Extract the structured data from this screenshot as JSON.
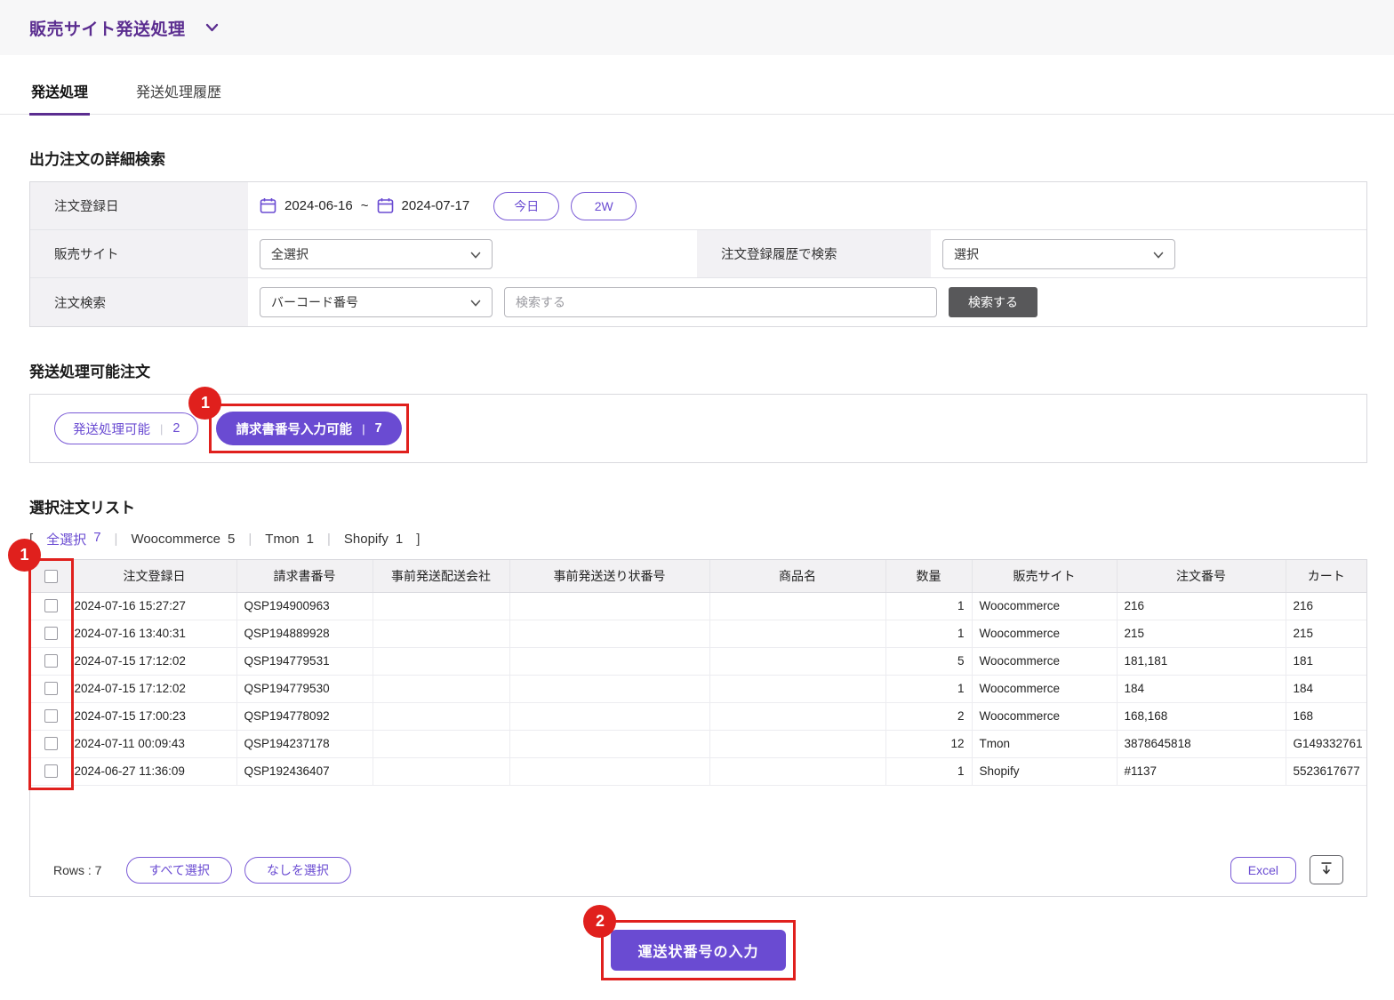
{
  "colors": {
    "accent": "#6a4bd2",
    "accent_deep": "#5b2d90",
    "annotation_red": "#e0201d",
    "dark_button": "#58585a"
  },
  "header": {
    "title": "販売サイト発送処理"
  },
  "tabs": {
    "shipping": "発送処理",
    "history": "発送処理履歴"
  },
  "search": {
    "section_title": "出力注文の詳細検索",
    "order_date": {
      "label": "注文登録日",
      "date_from": "2024-06-16",
      "separator": "~",
      "date_to": "2024-07-17",
      "today_button": "今日",
      "two_weeks_button": "2W"
    },
    "site": {
      "label": "販売サイト",
      "select_value": "全選択",
      "history_label": "注文登録履歴で検索",
      "history_select_value": "選択"
    },
    "order_search": {
      "label": "注文検索",
      "select_value": "バーコード番号",
      "input_placeholder": "検索する",
      "search_button": "検索する"
    }
  },
  "available": {
    "section_title": "発送処理可能注文",
    "shippable": {
      "label": "発送処理可能",
      "divider": "|",
      "count": "2"
    },
    "invoice": {
      "label": "請求書番号入力可能",
      "divider": "|",
      "count": "7"
    },
    "annotation": "1"
  },
  "order_list": {
    "section_title": "選択注文リスト",
    "bracket_open": "[",
    "bracket_close": "]",
    "separator": "|",
    "filters": [
      {
        "label": "全選択",
        "count": "7"
      },
      {
        "label": "Woocommerce",
        "count": "5"
      },
      {
        "label": "Tmon",
        "count": "1"
      },
      {
        "label": "Shopify",
        "count": "1"
      }
    ],
    "columns": [
      "注文登録日",
      "請求書番号",
      "事前発送配送会社",
      "事前発送送り状番号",
      "商品名",
      "数量",
      "販売サイト",
      "注文番号",
      "カート"
    ],
    "rows": [
      {
        "date": "2024-07-16 15:27:27",
        "invoice": "QSP194900963",
        "carrier": "",
        "tracking": "",
        "product": "",
        "qty": "1",
        "site": "Woocommerce",
        "order_no": "216",
        "cart": "216"
      },
      {
        "date": "2024-07-16 13:40:31",
        "invoice": "QSP194889928",
        "carrier": "",
        "tracking": "",
        "product": "",
        "qty": "1",
        "site": "Woocommerce",
        "order_no": "215",
        "cart": "215"
      },
      {
        "date": "2024-07-15 17:12:02",
        "invoice": "QSP194779531",
        "carrier": "",
        "tracking": "",
        "product": "",
        "qty": "5",
        "site": "Woocommerce",
        "order_no": "181,181",
        "cart": "181"
      },
      {
        "date": "2024-07-15 17:12:02",
        "invoice": "QSP194779530",
        "carrier": "",
        "tracking": "",
        "product": "",
        "qty": "1",
        "site": "Woocommerce",
        "order_no": "184",
        "cart": "184"
      },
      {
        "date": "2024-07-15 17:00:23",
        "invoice": "QSP194778092",
        "carrier": "",
        "tracking": "",
        "product": "",
        "qty": "2",
        "site": "Woocommerce",
        "order_no": "168,168",
        "cart": "168"
      },
      {
        "date": "2024-07-11 00:09:43",
        "invoice": "QSP194237178",
        "carrier": "",
        "tracking": "",
        "product": "",
        "qty": "12",
        "site": "Tmon",
        "order_no": "3878645818",
        "cart": "G149332761"
      },
      {
        "date": "2024-06-27 11:36:09",
        "invoice": "QSP192436407",
        "carrier": "",
        "tracking": "",
        "product": "",
        "qty": "1",
        "site": "Shopify",
        "order_no": "#1137",
        "cart": "5523617677"
      }
    ],
    "annotation": "1",
    "footer": {
      "rows_label": "Rows : 7",
      "select_all": "すべて選択",
      "select_none": "なしを選択",
      "excel": "Excel"
    }
  },
  "bottom": {
    "annotation": "2",
    "submit_button": "運送状番号の入力"
  }
}
